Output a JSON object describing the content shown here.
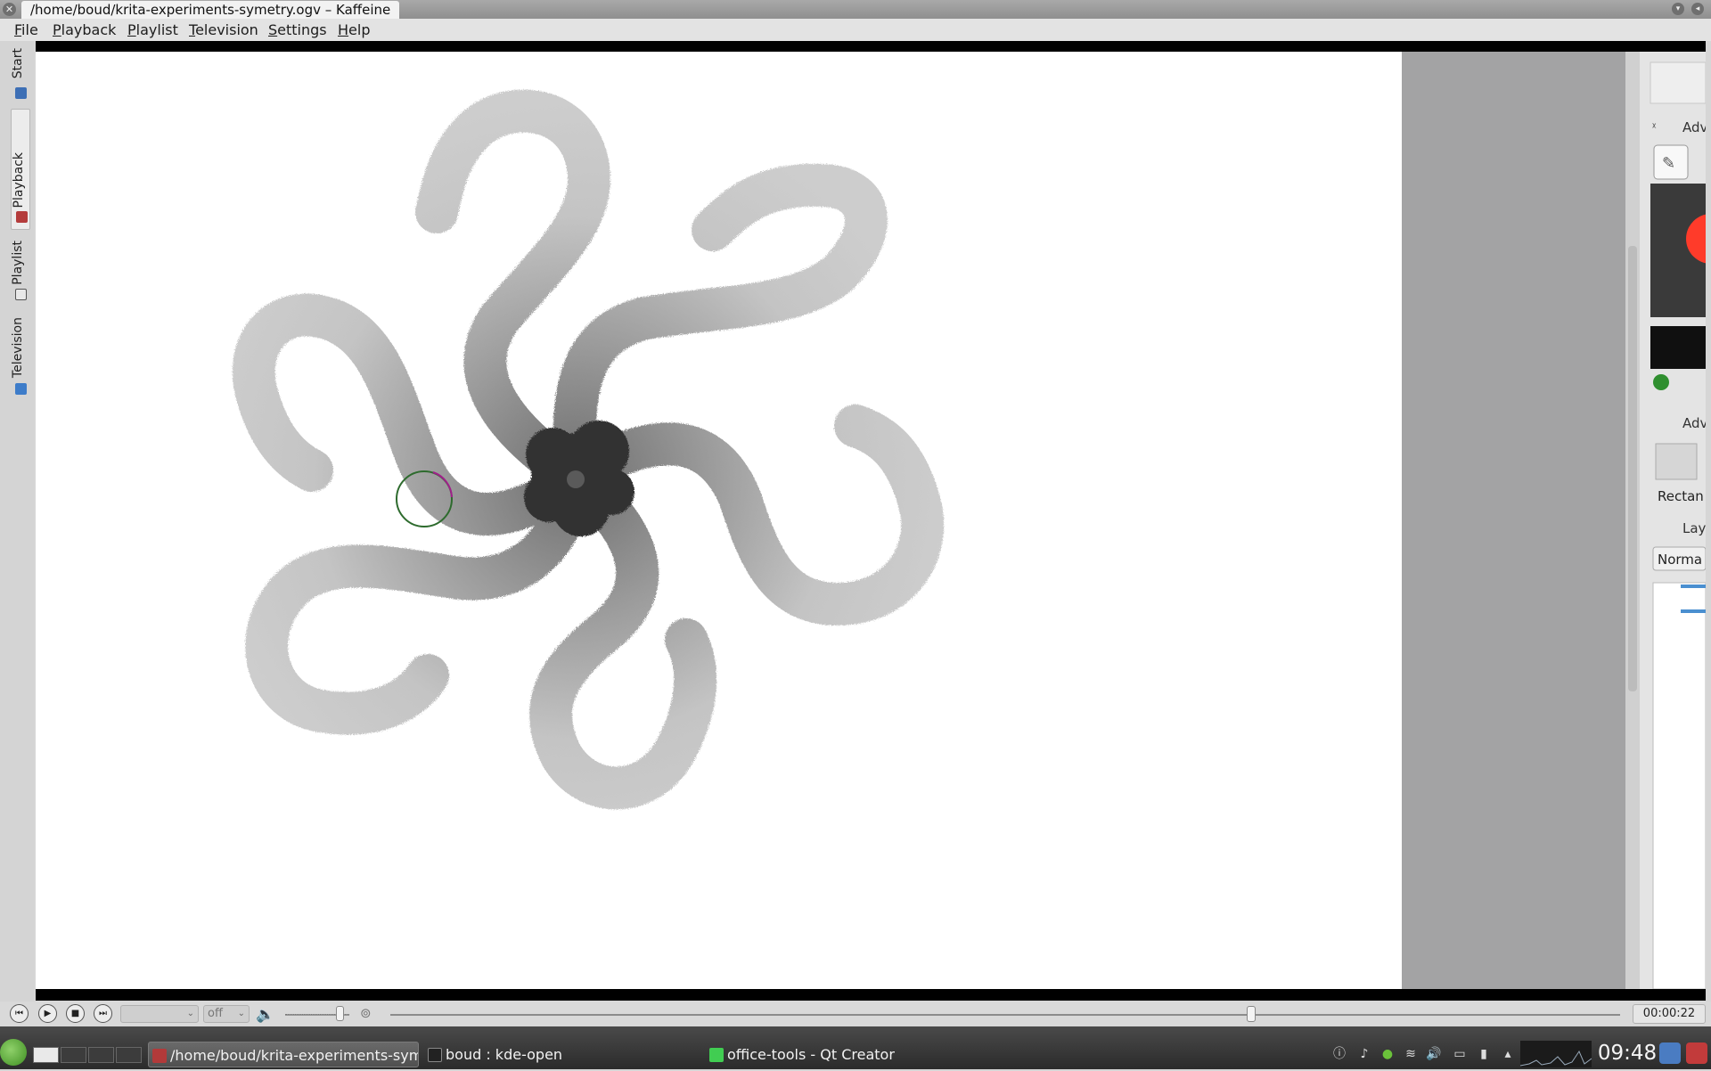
{
  "window": {
    "title": "/home/boud/krita-experiments-symetry.ogv – Kaffeine"
  },
  "menu": [
    "File",
    "Playback",
    "Playlist",
    "Television",
    "Settings",
    "Help"
  ],
  "side_tabs": [
    {
      "label": "Start",
      "icon": "start-icon"
    },
    {
      "label": "Playback",
      "icon": "playback-icon",
      "active": true
    },
    {
      "label": "Playlist",
      "icon": "playlist-icon"
    },
    {
      "label": "Television",
      "icon": "television-icon"
    }
  ],
  "video_frame": {
    "panel_labels": [
      "Adv",
      "Adv",
      "Lay"
    ],
    "preset_label": "Rectan",
    "blend_label": "Norma"
  },
  "controls": {
    "audio_combo_value": "",
    "subtitle_combo_value": "off",
    "volume_percent": 85,
    "seek_fraction": 0.7,
    "time": "00:00:22"
  },
  "taskbar": {
    "tasks": [
      {
        "label": "/home/boud/krita-experiments-syme",
        "icon": "kaffeine-icon",
        "active": true
      },
      {
        "label": "boud : kde-open",
        "icon": "terminal-icon",
        "active": false
      },
      {
        "label": "office-tools - Qt Creator",
        "icon": "qt-creator-icon",
        "active": false
      }
    ],
    "clock": "09:48"
  },
  "colors": {
    "cursor_circle": "#2e6b2e",
    "cursor_accent": "#a0208a",
    "pinwheel_dark": "#3a3a3a",
    "pinwheel_light": "#c8c8c8"
  }
}
